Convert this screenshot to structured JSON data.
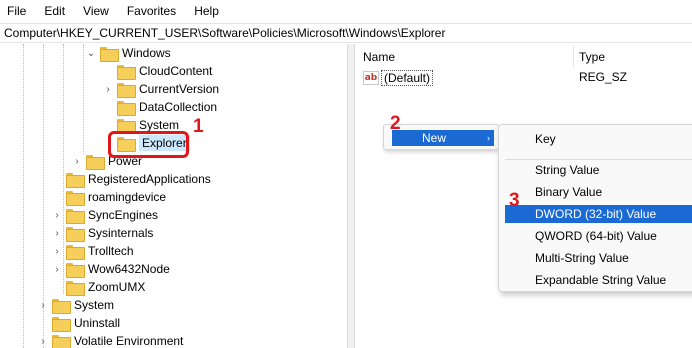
{
  "menubar": {
    "items": [
      "File",
      "Edit",
      "View",
      "Favorites",
      "Help"
    ]
  },
  "address": "Computer\\HKEY_CURRENT_USER\\Software\\Policies\\Microsoft\\Windows\\Explorer",
  "tree": {
    "windows": "Windows",
    "cloudcontent": "CloudContent",
    "currentversion": "CurrentVersion",
    "datacollection": "DataCollection",
    "system_child": "System",
    "explorer": "Explorer",
    "power": "Power",
    "registeredapps": "RegisteredApplications",
    "roamingdevice": "roamingdevice",
    "syncengines": "SyncEngines",
    "sysinternals": "Sysinternals",
    "trolltech": "Trolltech",
    "wow": "Wow6432Node",
    "zoomumx": "ZoomUMX",
    "system": "System",
    "uninstall": "Uninstall",
    "volatile": "Volatile Environment"
  },
  "list": {
    "col_name": "Name",
    "col_type": "Type",
    "default_icon": "ab",
    "default_name": "(Default)",
    "default_type": "REG_SZ"
  },
  "context": {
    "new_label": "New",
    "new_arrow": "›",
    "items": {
      "key": "Key",
      "string": "String Value",
      "binary": "Binary Value",
      "dword": "DWORD (32-bit) Value",
      "qword": "QWORD (64-bit) Value",
      "multistring": "Multi-String Value",
      "expandable": "Expandable String Value"
    }
  },
  "annotations": {
    "m1": "1",
    "m2": "2",
    "m3": "3",
    "color": "#e0161b"
  },
  "icons": {
    "folder": "folder-icon",
    "chevron_right": "›",
    "chevron_down": "⌄"
  }
}
